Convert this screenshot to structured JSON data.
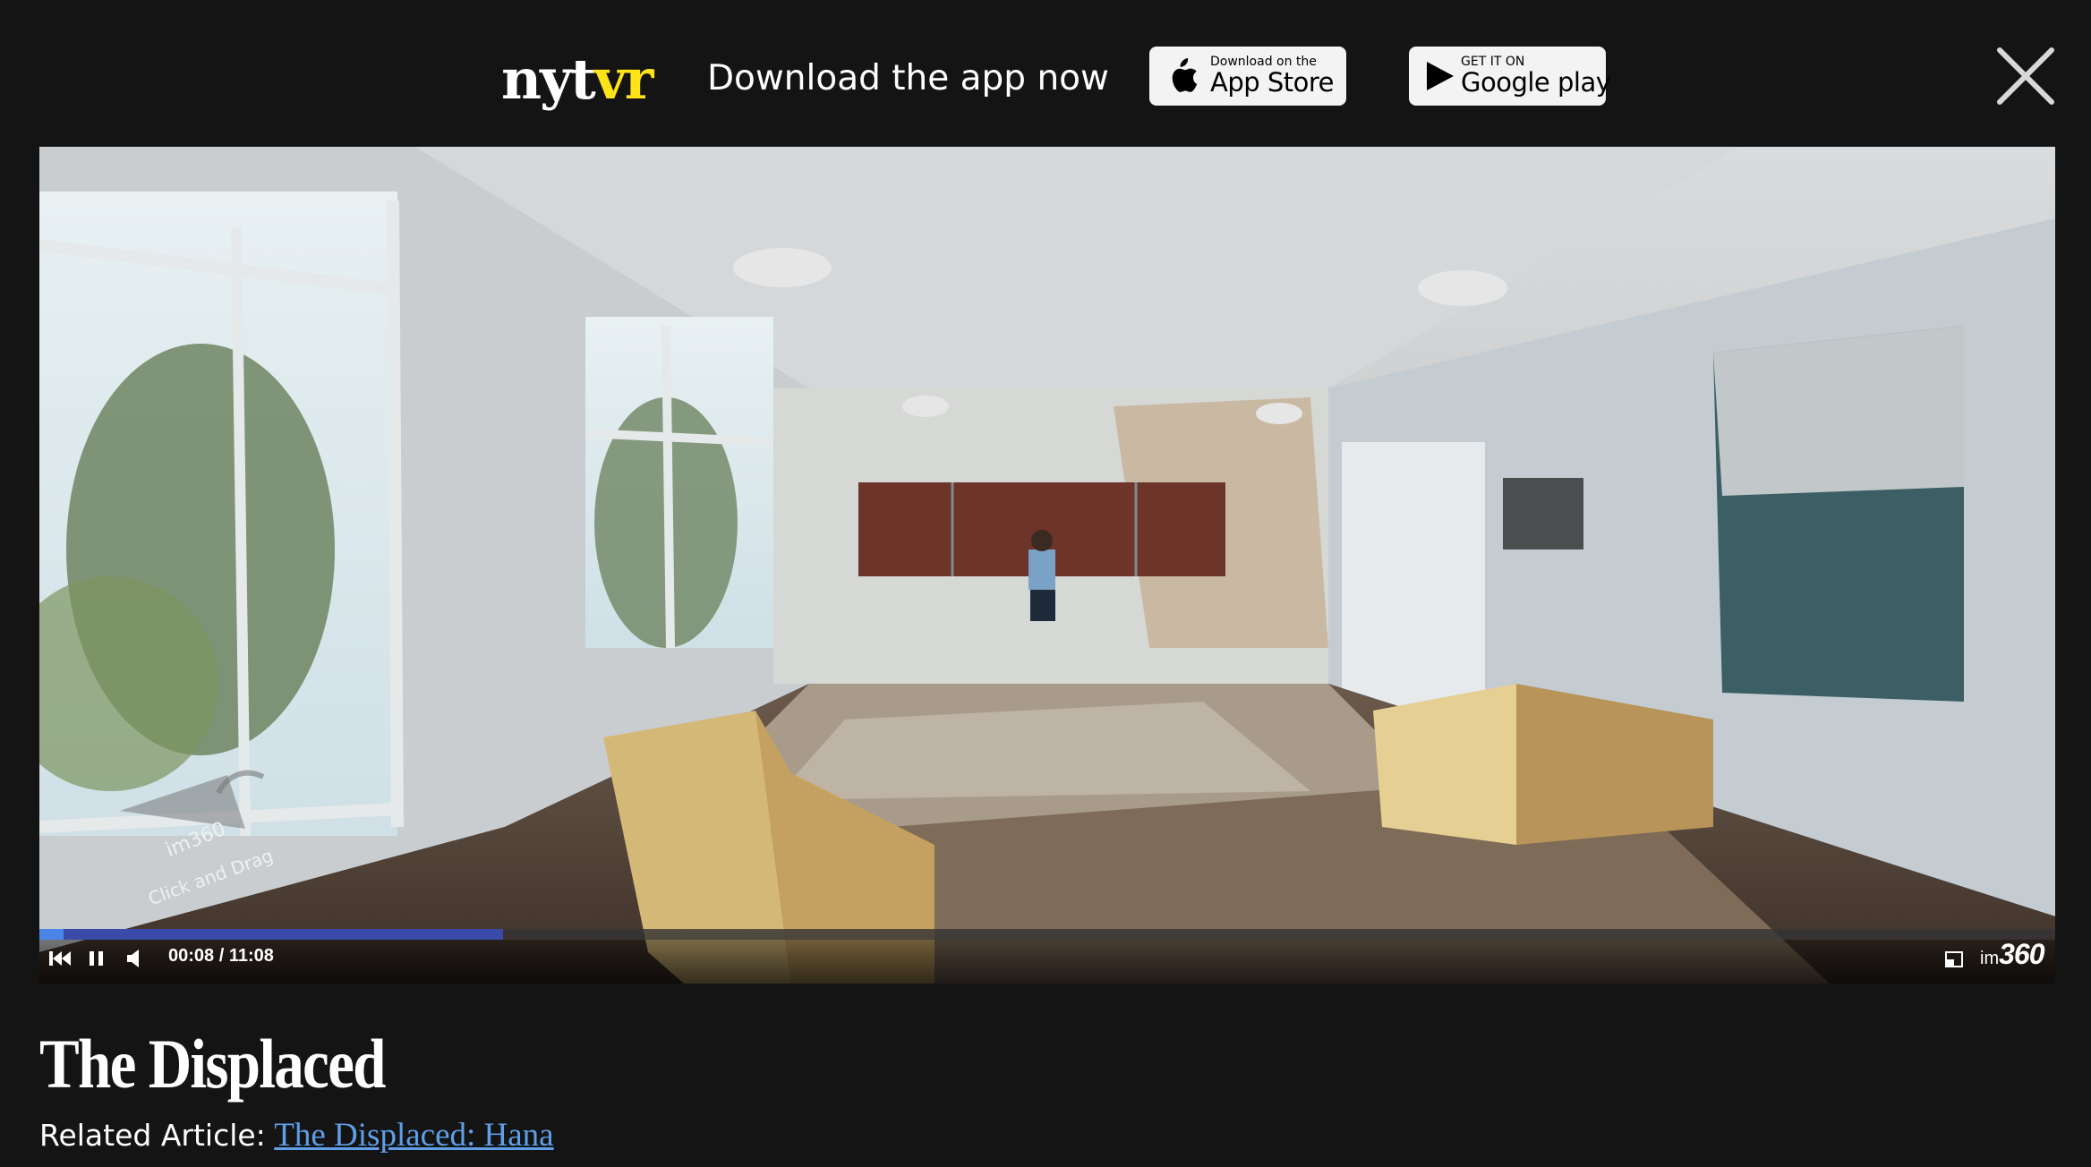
{
  "banner": {
    "logo_nyt": "nyt",
    "logo_vr": "vr",
    "tagline": "Download the app now",
    "app_store": {
      "small": "Download on the",
      "big": "App Store",
      "icon": "apple-icon"
    },
    "google_play": {
      "small": "GET IT ON",
      "big": "Google play",
      "icon": "play-triangle-icon"
    },
    "close_icon": "close-icon"
  },
  "player": {
    "hint_brand": "im360",
    "hint_text": "Click and Drag",
    "time_current": "00:08",
    "time_separator": "/",
    "time_total": "11:08",
    "progress_fraction": 0.012,
    "buffered_fraction": 0.23,
    "brand_prefix": "im",
    "brand_number": "360",
    "controls": [
      "skip-back-icon",
      "pause-icon",
      "volume-icon",
      "fullscreen-icon"
    ]
  },
  "page": {
    "title": "The Displaced",
    "related_label": "Related Article:",
    "related_link": "The Displaced: Hana"
  },
  "colors": {
    "background": "#141414",
    "logo_accent": "#ffe318",
    "link": "#5f9fe8",
    "progress": "#4a86e8"
  }
}
